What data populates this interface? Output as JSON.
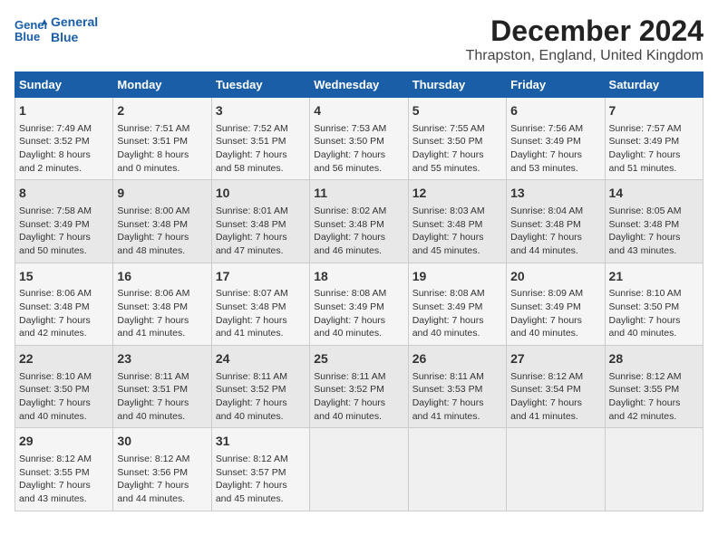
{
  "header": {
    "logo_line1": "General",
    "logo_line2": "Blue",
    "title": "December 2024",
    "subtitle": "Thrapston, England, United Kingdom"
  },
  "weekdays": [
    "Sunday",
    "Monday",
    "Tuesday",
    "Wednesday",
    "Thursday",
    "Friday",
    "Saturday"
  ],
  "weeks": [
    [
      {
        "day": "1",
        "lines": [
          "Sunrise: 7:49 AM",
          "Sunset: 3:52 PM",
          "Daylight: 8 hours",
          "and 2 minutes."
        ]
      },
      {
        "day": "2",
        "lines": [
          "Sunrise: 7:51 AM",
          "Sunset: 3:51 PM",
          "Daylight: 8 hours",
          "and 0 minutes."
        ]
      },
      {
        "day": "3",
        "lines": [
          "Sunrise: 7:52 AM",
          "Sunset: 3:51 PM",
          "Daylight: 7 hours",
          "and 58 minutes."
        ]
      },
      {
        "day": "4",
        "lines": [
          "Sunrise: 7:53 AM",
          "Sunset: 3:50 PM",
          "Daylight: 7 hours",
          "and 56 minutes."
        ]
      },
      {
        "day": "5",
        "lines": [
          "Sunrise: 7:55 AM",
          "Sunset: 3:50 PM",
          "Daylight: 7 hours",
          "and 55 minutes."
        ]
      },
      {
        "day": "6",
        "lines": [
          "Sunrise: 7:56 AM",
          "Sunset: 3:49 PM",
          "Daylight: 7 hours",
          "and 53 minutes."
        ]
      },
      {
        "day": "7",
        "lines": [
          "Sunrise: 7:57 AM",
          "Sunset: 3:49 PM",
          "Daylight: 7 hours",
          "and 51 minutes."
        ]
      }
    ],
    [
      {
        "day": "8",
        "lines": [
          "Sunrise: 7:58 AM",
          "Sunset: 3:49 PM",
          "Daylight: 7 hours",
          "and 50 minutes."
        ]
      },
      {
        "day": "9",
        "lines": [
          "Sunrise: 8:00 AM",
          "Sunset: 3:48 PM",
          "Daylight: 7 hours",
          "and 48 minutes."
        ]
      },
      {
        "day": "10",
        "lines": [
          "Sunrise: 8:01 AM",
          "Sunset: 3:48 PM",
          "Daylight: 7 hours",
          "and 47 minutes."
        ]
      },
      {
        "day": "11",
        "lines": [
          "Sunrise: 8:02 AM",
          "Sunset: 3:48 PM",
          "Daylight: 7 hours",
          "and 46 minutes."
        ]
      },
      {
        "day": "12",
        "lines": [
          "Sunrise: 8:03 AM",
          "Sunset: 3:48 PM",
          "Daylight: 7 hours",
          "and 45 minutes."
        ]
      },
      {
        "day": "13",
        "lines": [
          "Sunrise: 8:04 AM",
          "Sunset: 3:48 PM",
          "Daylight: 7 hours",
          "and 44 minutes."
        ]
      },
      {
        "day": "14",
        "lines": [
          "Sunrise: 8:05 AM",
          "Sunset: 3:48 PM",
          "Daylight: 7 hours",
          "and 43 minutes."
        ]
      }
    ],
    [
      {
        "day": "15",
        "lines": [
          "Sunrise: 8:06 AM",
          "Sunset: 3:48 PM",
          "Daylight: 7 hours",
          "and 42 minutes."
        ]
      },
      {
        "day": "16",
        "lines": [
          "Sunrise: 8:06 AM",
          "Sunset: 3:48 PM",
          "Daylight: 7 hours",
          "and 41 minutes."
        ]
      },
      {
        "day": "17",
        "lines": [
          "Sunrise: 8:07 AM",
          "Sunset: 3:48 PM",
          "Daylight: 7 hours",
          "and 41 minutes."
        ]
      },
      {
        "day": "18",
        "lines": [
          "Sunrise: 8:08 AM",
          "Sunset: 3:49 PM",
          "Daylight: 7 hours",
          "and 40 minutes."
        ]
      },
      {
        "day": "19",
        "lines": [
          "Sunrise: 8:08 AM",
          "Sunset: 3:49 PM",
          "Daylight: 7 hours",
          "and 40 minutes."
        ]
      },
      {
        "day": "20",
        "lines": [
          "Sunrise: 8:09 AM",
          "Sunset: 3:49 PM",
          "Daylight: 7 hours",
          "and 40 minutes."
        ]
      },
      {
        "day": "21",
        "lines": [
          "Sunrise: 8:10 AM",
          "Sunset: 3:50 PM",
          "Daylight: 7 hours",
          "and 40 minutes."
        ]
      }
    ],
    [
      {
        "day": "22",
        "lines": [
          "Sunrise: 8:10 AM",
          "Sunset: 3:50 PM",
          "Daylight: 7 hours",
          "and 40 minutes."
        ]
      },
      {
        "day": "23",
        "lines": [
          "Sunrise: 8:11 AM",
          "Sunset: 3:51 PM",
          "Daylight: 7 hours",
          "and 40 minutes."
        ]
      },
      {
        "day": "24",
        "lines": [
          "Sunrise: 8:11 AM",
          "Sunset: 3:52 PM",
          "Daylight: 7 hours",
          "and 40 minutes."
        ]
      },
      {
        "day": "25",
        "lines": [
          "Sunrise: 8:11 AM",
          "Sunset: 3:52 PM",
          "Daylight: 7 hours",
          "and 40 minutes."
        ]
      },
      {
        "day": "26",
        "lines": [
          "Sunrise: 8:11 AM",
          "Sunset: 3:53 PM",
          "Daylight: 7 hours",
          "and 41 minutes."
        ]
      },
      {
        "day": "27",
        "lines": [
          "Sunrise: 8:12 AM",
          "Sunset: 3:54 PM",
          "Daylight: 7 hours",
          "and 41 minutes."
        ]
      },
      {
        "day": "28",
        "lines": [
          "Sunrise: 8:12 AM",
          "Sunset: 3:55 PM",
          "Daylight: 7 hours",
          "and 42 minutes."
        ]
      }
    ],
    [
      {
        "day": "29",
        "lines": [
          "Sunrise: 8:12 AM",
          "Sunset: 3:55 PM",
          "Daylight: 7 hours",
          "and 43 minutes."
        ]
      },
      {
        "day": "30",
        "lines": [
          "Sunrise: 8:12 AM",
          "Sunset: 3:56 PM",
          "Daylight: 7 hours",
          "and 44 minutes."
        ]
      },
      {
        "day": "31",
        "lines": [
          "Sunrise: 8:12 AM",
          "Sunset: 3:57 PM",
          "Daylight: 7 hours",
          "and 45 minutes."
        ]
      },
      null,
      null,
      null,
      null
    ]
  ]
}
